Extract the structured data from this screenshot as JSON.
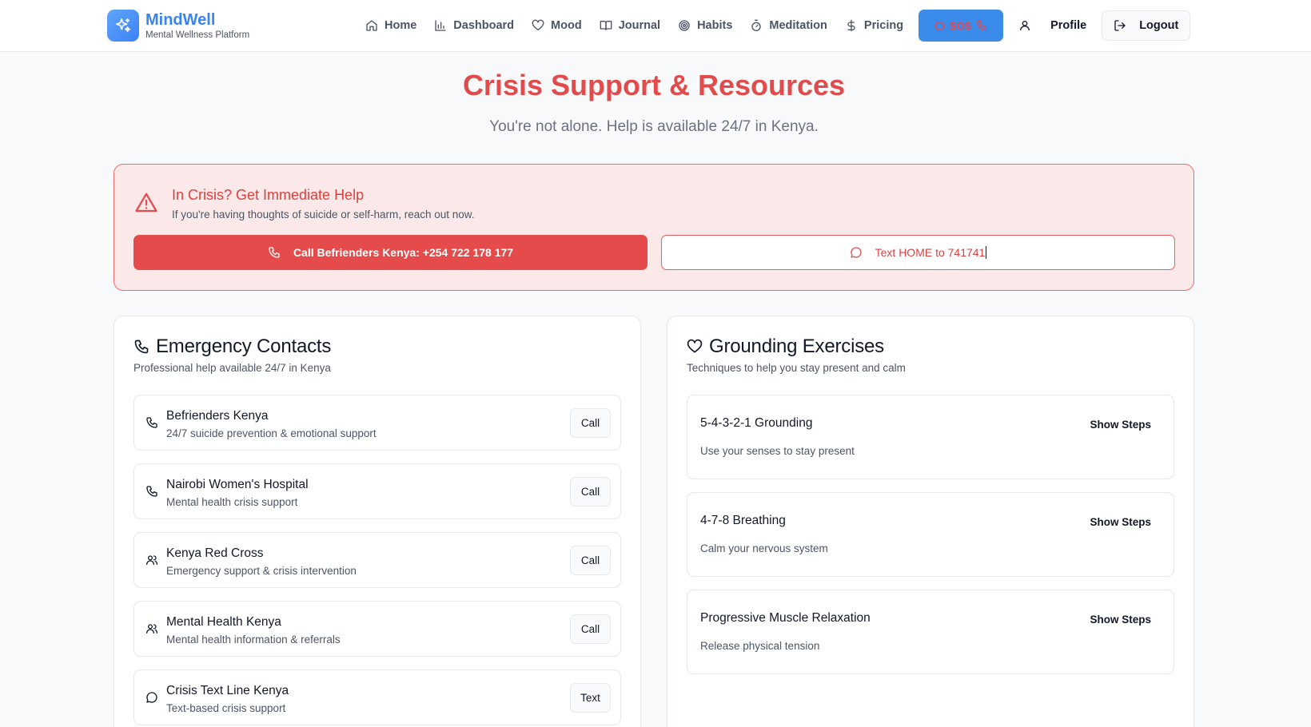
{
  "brand": {
    "name": "MindWell",
    "tagline": "Mental Wellness Platform",
    "accent": "#3b82f6"
  },
  "nav": {
    "items": [
      {
        "label": "Home",
        "icon": "home-icon"
      },
      {
        "label": "Dashboard",
        "icon": "bar-chart-icon"
      },
      {
        "label": "Mood",
        "icon": "heart-icon"
      },
      {
        "label": "Journal",
        "icon": "book-icon"
      },
      {
        "label": "Habits",
        "icon": "target-icon"
      },
      {
        "label": "Meditation",
        "icon": "timer-icon"
      },
      {
        "label": "Pricing",
        "icon": "dollar-icon"
      }
    ],
    "sos_label": "SOS",
    "profile_label": "Profile",
    "logout_label": "Logout"
  },
  "hero": {
    "title": "Crisis Support & Resources",
    "subtitle": "You're not alone. Help is available 24/7 in Kenya."
  },
  "crisis": {
    "title": "In Crisis? Get Immediate Help",
    "description": "If you're having thoughts of suicide or self-harm, reach out now.",
    "call_label": "Call Befrienders Kenya: +254 722 178 177",
    "text_label": "Text HOME to 741741",
    "accent": "#e54b4b"
  },
  "contacts": {
    "title": "Emergency Contacts",
    "subtitle": "Professional help available 24/7 in Kenya",
    "items": [
      {
        "name": "Befrienders Kenya",
        "description": "24/7 suicide prevention & emotional support",
        "action": "Call",
        "icon": "phone-icon"
      },
      {
        "name": "Nairobi Women's Hospital",
        "description": "Mental health crisis support",
        "action": "Call",
        "icon": "phone-icon"
      },
      {
        "name": "Kenya Red Cross",
        "description": "Emergency support & crisis intervention",
        "action": "Call",
        "icon": "users-icon"
      },
      {
        "name": "Mental Health Kenya",
        "description": "Mental health information & referrals",
        "action": "Call",
        "icon": "users-icon"
      },
      {
        "name": "Crisis Text Line Kenya",
        "description": "Text-based crisis support",
        "action": "Text",
        "icon": "message-icon"
      }
    ]
  },
  "grounding": {
    "title": "Grounding Exercises",
    "subtitle": "Techniques to help you stay present and calm",
    "items": [
      {
        "name": "5-4-3-2-1 Grounding",
        "description": "Use your senses to stay present",
        "action": "Show Steps"
      },
      {
        "name": "4-7-8 Breathing",
        "description": "Calm your nervous system",
        "action": "Show Steps"
      },
      {
        "name": "Progressive Muscle Relaxation",
        "description": "Release physical tension",
        "action": "Show Steps"
      }
    ]
  }
}
